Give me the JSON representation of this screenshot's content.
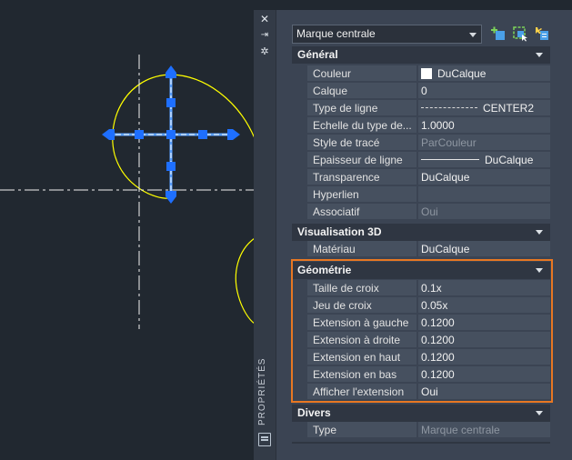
{
  "colors": {
    "background": "#212830",
    "highlight_border": "#e87722",
    "grip_blue": "#1e6fff",
    "circle_yellow": "#ffff00"
  },
  "sidebar": {
    "title": "PROPRIÉTÉS",
    "close_icon": "close-icon",
    "autohide_icon": "autohide-icon",
    "settings_icon": "settings-icon"
  },
  "header": {
    "object_type": "Marque centrale",
    "toolbar_icons": [
      "toggle-pickadd-icon",
      "select-objects-icon",
      "quick-select-icon"
    ]
  },
  "sections": [
    {
      "title": "Général",
      "rows": [
        {
          "label": "Couleur",
          "value": "DuCalque",
          "swatch": "#ffffff"
        },
        {
          "label": "Calque",
          "value": "0"
        },
        {
          "label": "Type de ligne",
          "value": "CENTER2",
          "preview": "dash"
        },
        {
          "label": "Echelle du type de...",
          "value": "1.0000"
        },
        {
          "label": "Style de tracé",
          "value": "ParCouleur",
          "dim": true
        },
        {
          "label": "Epaisseur de ligne",
          "value": "DuCalque",
          "preview": "solid"
        },
        {
          "label": "Transparence",
          "value": "DuCalque"
        },
        {
          "label": "Hyperlien",
          "value": ""
        },
        {
          "label": "Associatif",
          "value": "Oui",
          "dim": true
        }
      ]
    },
    {
      "title": "Visualisation 3D",
      "rows": [
        {
          "label": "Matériau",
          "value": "DuCalque"
        }
      ]
    },
    {
      "title": "Géométrie",
      "rows": [
        {
          "label": "Taille de croix",
          "value": "0.1x"
        },
        {
          "label": "Jeu de croix",
          "value": "0.05x"
        },
        {
          "label": "Extension à gauche",
          "value": "0.1200"
        },
        {
          "label": "Extension à droite",
          "value": "0.1200"
        },
        {
          "label": "Extension en haut",
          "value": "0.1200"
        },
        {
          "label": "Extension en bas",
          "value": "0.1200"
        },
        {
          "label": "Afficher l'extension",
          "value": "Oui"
        }
      ]
    },
    {
      "title": "Divers",
      "rows": [
        {
          "label": "Type",
          "value": "Marque centrale",
          "dim": true
        }
      ]
    }
  ]
}
